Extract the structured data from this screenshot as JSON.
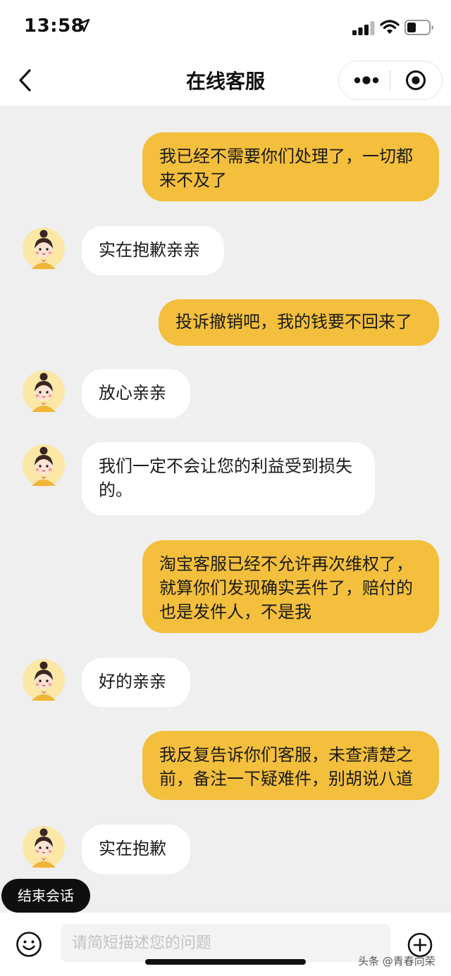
{
  "status": {
    "time": "13:58"
  },
  "nav": {
    "title": "在线客服"
  },
  "messages": [
    {
      "from": "user",
      "text": "我已经不需要你们处理了，一切都来不及了"
    },
    {
      "from": "agent",
      "text": "实在抱歉亲亲"
    },
    {
      "from": "user",
      "text": "投诉撤销吧，我的钱要不回来了"
    },
    {
      "from": "agent",
      "text": "放心亲亲"
    },
    {
      "from": "agent",
      "text": "我们一定不会让您的利益受到损失的。"
    },
    {
      "from": "user",
      "text": "淘宝客服已经不允许再次维权了，就算你们发现确实丢件了，赔付的也是发件人，不是我"
    },
    {
      "from": "agent",
      "text": "好的亲亲"
    },
    {
      "from": "user",
      "text": "我反复告诉你们客服，未查清楚之前，备注一下疑难件，别胡说八道"
    },
    {
      "from": "agent",
      "text": "实在抱歉"
    }
  ],
  "end_chat_label": "结束会话",
  "input": {
    "placeholder": "请简短描述您的问题"
  },
  "watermark": "头条 @青春向荣",
  "colors": {
    "user_bubble": "#f3bf3c",
    "agent_bubble": "#ffffff",
    "chat_bg": "#efefef"
  },
  "icons": [
    "location-arrow-icon",
    "signal-icon",
    "wifi-icon",
    "battery-icon",
    "back-icon",
    "more-icon",
    "target-icon",
    "emoji-icon",
    "plus-icon",
    "avatar-icon"
  ]
}
